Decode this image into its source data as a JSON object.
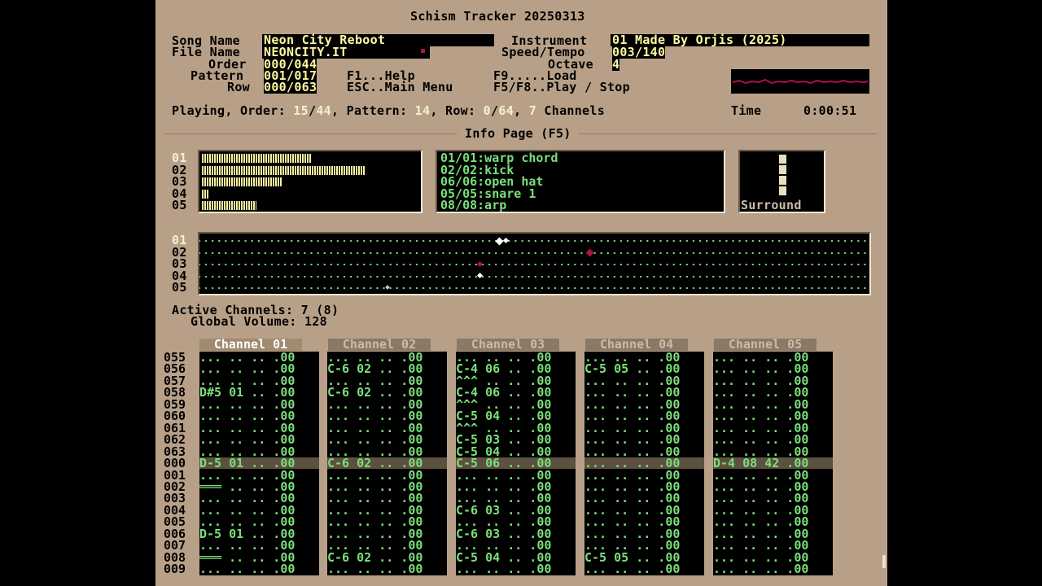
{
  "app_title": "Schism Tracker 20250313",
  "header": {
    "song_name_label": "Song Name",
    "song_name": "Neon City Reboot",
    "file_name_label": "File Name",
    "file_name": "NEONCITY.IT",
    "order_label": "Order",
    "order": "000/044",
    "pattern_label": "Pattern",
    "pattern": "001/017",
    "row_label": "Row",
    "row": "000/063",
    "instrument_label": "Instrument",
    "instrument": "01 Made By Orjis (2025)",
    "speed_label": "Speed/Tempo",
    "speed": "003/140",
    "octave_label": "Octave",
    "octave": "4",
    "help_f1": "F1...Help",
    "help_esc": "ESC..Main Menu",
    "help_f9": "F9.....Load",
    "help_f5": "F5/F8..Play / Stop"
  },
  "status": {
    "playing_label": "Playing, Order:",
    "order_cur": "15",
    "order_total": "44",
    "pattern_label": ", Pattern:",
    "pattern_cur": "14",
    "row_label": ", Row:",
    "row_cur": "0",
    "row_total": "64",
    "channels_sep": ",",
    "channels_count": "7",
    "channels_label": "Channels",
    "time_label": "Time",
    "time": "0:00:51"
  },
  "info_page_title": "Info Page (F5)",
  "vu_channels": [
    "01",
    "02",
    "03",
    "04",
    "05"
  ],
  "vu_levels": [
    0.5,
    0.75,
    0.37,
    0.03,
    0.25
  ],
  "samples": [
    "01/01:warp chord",
    "02/02:kick",
    "06/06:open hat",
    "05/05:snare 1",
    "08/08:arp"
  ],
  "surround_label": "Surround",
  "scope_channels": [
    "01",
    "02",
    "03",
    "04",
    "05"
  ],
  "active_channels_label": "Active Channels:",
  "active_channels": "7 (8)",
  "global_volume_label": "Global Volume:",
  "global_volume": "128",
  "channel_headers": [
    "Channel 01",
    "Channel 02",
    "Channel 03",
    "Channel 04",
    "Channel 05"
  ],
  "row_numbers": [
    "055",
    "056",
    "057",
    "058",
    "059",
    "060",
    "061",
    "062",
    "063",
    "000",
    "001",
    "002",
    "003",
    "004",
    "005",
    "006",
    "007",
    "008",
    "009"
  ],
  "pattern_channels": [
    [
      "... .. .. .00",
      "... .. .. .00",
      "... .. .. .00",
      "D#5 01 .. .00",
      "... .. .. .00",
      "... .. .. .00",
      "... .. .. .00",
      "... .. .. .00",
      "... .. .. .00",
      "D-5 01 .. .00",
      "... .. .. .00",
      "═══ .. .. .00",
      "... .. .. .00",
      "... .. .. .00",
      "... .. .. .00",
      "D-5 01 .. .00",
      "... .. .. .00",
      "═══ .. .. .00",
      "... .. .. .00"
    ],
    [
      "... .. .. .00",
      "C-6 02 .. .00",
      "... .. .. .00",
      "C-6 02 .. .00",
      "... .. .. .00",
      "... .. .. .00",
      "... .. .. .00",
      "... .. .. .00",
      "... .. .. .00",
      "C-6 02 .. .00",
      "... .. .. .00",
      "... .. .. .00",
      "... .. .. .00",
      "... .. .. .00",
      "... .. .. .00",
      "... .. .. .00",
      "... .. .. .00",
      "C-6 02 .. .00",
      "... .. .. .00"
    ],
    [
      "... .. .. .00",
      "C-4 06 .. .00",
      "^^^ .. .. .00",
      "C-4 06 .. .00",
      "^^^ .. .. .00",
      "C-5 04 .. .00",
      "^^^ .. .. .00",
      "C-5 03 .. .00",
      "C-5 04 .. .00",
      "C-5 06 .. .00",
      "... .. .. .00",
      "... .. .. .00",
      "... .. .. .00",
      "C-6 03 .. .00",
      "... .. .. .00",
      "C-6 03 .. .00",
      "... .. .. .00",
      "C-5 04 .. .00",
      "... .. .. .00"
    ],
    [
      "... .. .. .00",
      "C-5 05 .. .00",
      "... .. .. .00",
      "... .. .. .00",
      "... .. .. .00",
      "... .. .. .00",
      "... .. .. .00",
      "... .. .. .00",
      "... .. .. .00",
      "... .. .. .00",
      "... .. .. .00",
      "... .. .. .00",
      "... .. .. .00",
      "... .. .. .00",
      "... .. .. .00",
      "... .. .. .00",
      "... .. .. .00",
      "C-5 05 .. .00",
      "... .. .. .00"
    ],
    [
      "... .. .. .00",
      "... .. .. .00",
      "... .. .. .00",
      "... .. .. .00",
      "... .. .. .00",
      "... .. .. .00",
      "... .. .. .00",
      "... .. .. .00",
      "... .. .. .00",
      "D-4 08 42 .00",
      "... .. .. .00",
      "... .. .. .00",
      "... .. .. .00",
      "... .. .. .00",
      "... .. .. .00",
      "... .. .. .00",
      "... .. .. .00",
      "... .. .. .00",
      "... .. .. .00"
    ]
  ],
  "colors": {
    "bg": "#b8a088",
    "value_text": "#fff9a0",
    "note_green": "#7adf7a",
    "vu_yellow": "#f8f0a0",
    "scope_marker_red": "#b0104a"
  }
}
